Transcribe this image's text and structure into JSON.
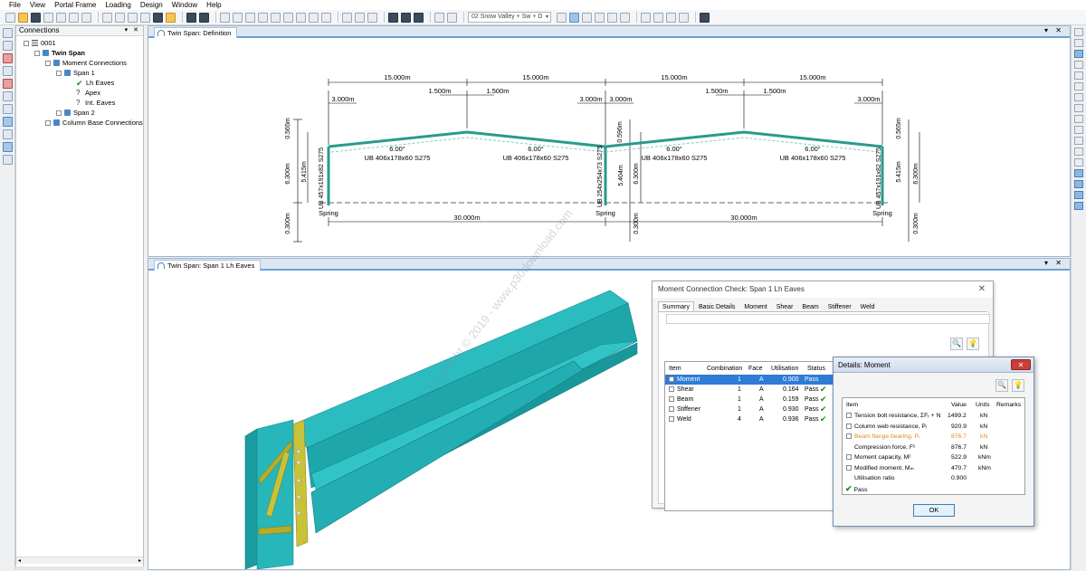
{
  "menu": [
    "File",
    "View",
    "Portal Frame",
    "Loading",
    "Design",
    "Window",
    "Help"
  ],
  "toolbar": {
    "load_case": "02 Snow Valley + Sw + D"
  },
  "connections": {
    "title": "Connections",
    "panel_controls": "▾ ✕",
    "tree": [
      {
        "label": "0001",
        "bold": false
      },
      {
        "label": "Twin Span",
        "bold": true
      },
      {
        "label": "Moment Connections",
        "bold": false
      },
      {
        "label": "Span 1",
        "bold": false
      },
      {
        "label": "Lh Eaves",
        "bold": false
      },
      {
        "label": "Apex",
        "bold": false
      },
      {
        "label": "Int. Eaves",
        "bold": false
      },
      {
        "label": "Span 2",
        "bold": false
      },
      {
        "label": "Column Base Connections",
        "bold": false
      }
    ]
  },
  "definition_tab": {
    "title": "Twin Span: Definition",
    "controls": "▾ ✕"
  },
  "frame": {
    "top_spans": [
      "15.000m",
      "15.000m",
      "15.000m",
      "15.000m"
    ],
    "sub_dims": [
      "3.000m",
      "1.500m",
      "1.500m",
      "3.000m",
      "3.000m",
      "1.500m",
      "1.500m",
      "3.000m"
    ],
    "pitch": [
      "6.00°",
      "6.00°",
      "6.00°",
      "6.00°"
    ],
    "rafters": [
      "UB 406x178x60 S275",
      "UB 406x178x60 S275",
      "UB 406x178x60 S275",
      "UB 406x178x60 S275"
    ],
    "columns": [
      "UB 457x191x82 S275",
      "UB 254x254x73 S275",
      "UB 457x191x82 S275"
    ],
    "supports": [
      "Spring",
      "Spring",
      "Spring"
    ],
    "bottom_spans": [
      "30.000m",
      "30.000m"
    ],
    "left_dims": [
      "0.565m",
      "6.300m",
      "0.300m",
      "5.415m"
    ],
    "mid_dims": [
      "0.596m",
      "5.404m",
      "6.300m",
      "0.300m"
    ],
    "right_dims": [
      "0.565m",
      "5.415m",
      "6.300m",
      "0.300m"
    ]
  },
  "view3d_tab": {
    "title": "Twin Span: Span 1 Lh Eaves",
    "controls": "▾ ✕"
  },
  "watermark": "Copyright © 2019 - www.p30download.com",
  "moment_check": {
    "title": "Moment Connection Check: Span 1 Lh Eaves",
    "close": "✕",
    "tabs": [
      "Summary",
      "Basic Details",
      "Moment",
      "Shear",
      "Beam",
      "Stiffener",
      "Weld"
    ],
    "search_icon": "🔍",
    "bulb_icon": "💡",
    "columns": [
      "Item",
      "Combination",
      "Face",
      "Utilisation",
      "Status"
    ],
    "rows": [
      {
        "item": "Moment",
        "combination": "1",
        "face": "A",
        "utilisation": "0.900",
        "status": "Pass"
      },
      {
        "item": "Shear",
        "combination": "1",
        "face": "A",
        "utilisation": "0.164",
        "status": "Pass"
      },
      {
        "item": "Beam",
        "combination": "1",
        "face": "A",
        "utilisation": "0.159",
        "status": "Pass"
      },
      {
        "item": "Stiffener",
        "combination": "1",
        "face": "A",
        "utilisation": "0.930",
        "status": "Pass"
      },
      {
        "item": "Weld",
        "combination": "4",
        "face": "A",
        "utilisation": "0.936",
        "status": "Pass"
      }
    ]
  },
  "details": {
    "title": "Details: Moment",
    "close": "✕",
    "search_icon": "🔍",
    "bulb_icon": "💡",
    "columns": [
      "Item",
      "Value",
      "Units",
      "Remarks"
    ],
    "rows": [
      {
        "item": "Tension bolt resistance, ΣFᵣ + N",
        "value": "1499.2",
        "units": "kN",
        "expand": true,
        "dim": false
      },
      {
        "item": "Column web resistance, Pᵢ",
        "value": "920.9",
        "units": "kN",
        "expand": true,
        "dim": false
      },
      {
        "item": "Beam flange bearing, Pᵣ",
        "value": "876.7",
        "units": "kN",
        "expand": true,
        "dim": true
      },
      {
        "item": "Compression force, Fᶜ",
        "value": "876.7",
        "units": "kN",
        "expand": false,
        "dim": false
      },
      {
        "item": "Moment capacity, Mᶜ",
        "value": "522.9",
        "units": "kNm",
        "expand": true,
        "dim": false
      },
      {
        "item": "Modified moment, Mₘ",
        "value": "470.7",
        "units": "kNm",
        "expand": true,
        "dim": false
      },
      {
        "item": "Utilisation ratio",
        "value": "0.900",
        "units": "",
        "expand": false,
        "dim": false
      }
    ],
    "result": "Pass",
    "ok_label": "OK"
  }
}
